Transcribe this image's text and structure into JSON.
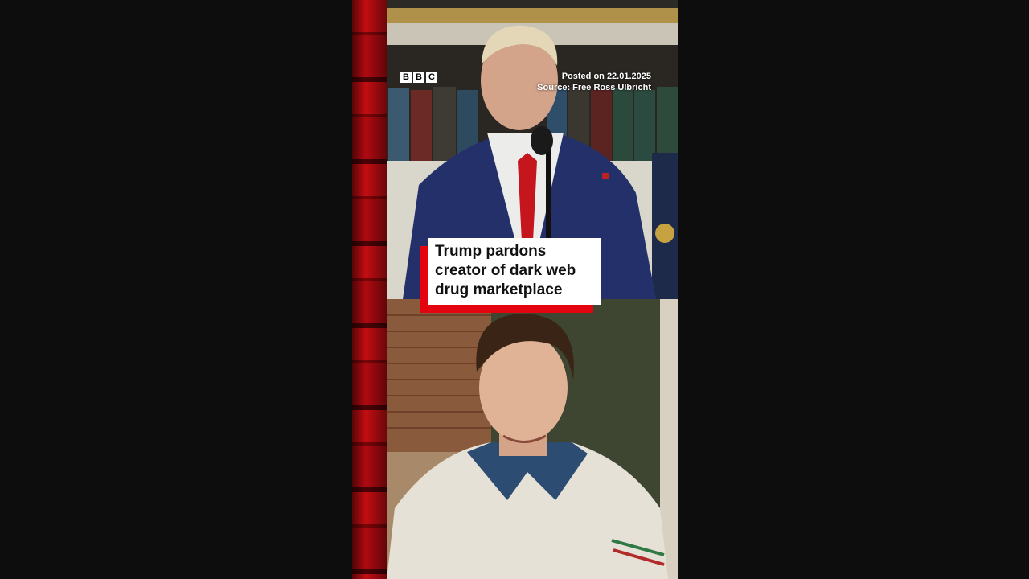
{
  "brand": {
    "letters": [
      "B",
      "B",
      "C"
    ]
  },
  "meta": {
    "posted": "Posted on 22.01.2025",
    "source": "Source: Free Ross Ulbricht"
  },
  "headline": "Trump pardons creator of dark web drug marketplace",
  "colors": {
    "accent_red": "#e4040f",
    "background": "#0d0d0d"
  }
}
